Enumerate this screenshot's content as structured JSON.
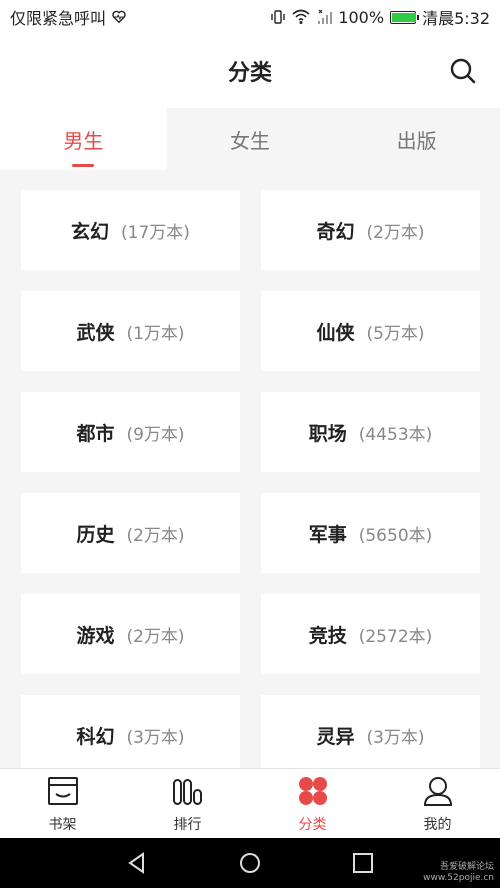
{
  "status_bar": {
    "carrier": "仅限紧急呼叫",
    "battery": "100%",
    "time": "清晨5:32"
  },
  "header": {
    "title": "分类"
  },
  "tabs": [
    {
      "label": "男生",
      "active": true
    },
    {
      "label": "女生",
      "active": false
    },
    {
      "label": "出版",
      "active": false
    }
  ],
  "categories": [
    {
      "name": "玄幻",
      "count": "(17万本)"
    },
    {
      "name": "奇幻",
      "count": "(2万本)"
    },
    {
      "name": "武侠",
      "count": "(1万本)"
    },
    {
      "name": "仙侠",
      "count": "(5万本)"
    },
    {
      "name": "都市",
      "count": "(9万本)"
    },
    {
      "name": "职场",
      "count": "(4453本)"
    },
    {
      "name": "历史",
      "count": "(2万本)"
    },
    {
      "name": "军事",
      "count": "(5650本)"
    },
    {
      "name": "游戏",
      "count": "(2万本)"
    },
    {
      "name": "竞技",
      "count": "(2572本)"
    },
    {
      "name": "科幻",
      "count": "(3万本)"
    },
    {
      "name": "灵异",
      "count": "(3万本)"
    }
  ],
  "bottom_nav": [
    {
      "label": "书架",
      "icon": "bookshelf-icon"
    },
    {
      "label": "排行",
      "icon": "ranking-icon"
    },
    {
      "label": "分类",
      "icon": "category-icon",
      "active": true
    },
    {
      "label": "我的",
      "icon": "profile-icon"
    }
  ],
  "watermark": {
    "line1": "吾爱破解论坛",
    "line2": "www.52pojie.cn"
  },
  "colors": {
    "accent": "#e84a4a",
    "background": "#f5f5f5",
    "card": "#ffffff",
    "text": "#222222",
    "muted": "#888888"
  }
}
